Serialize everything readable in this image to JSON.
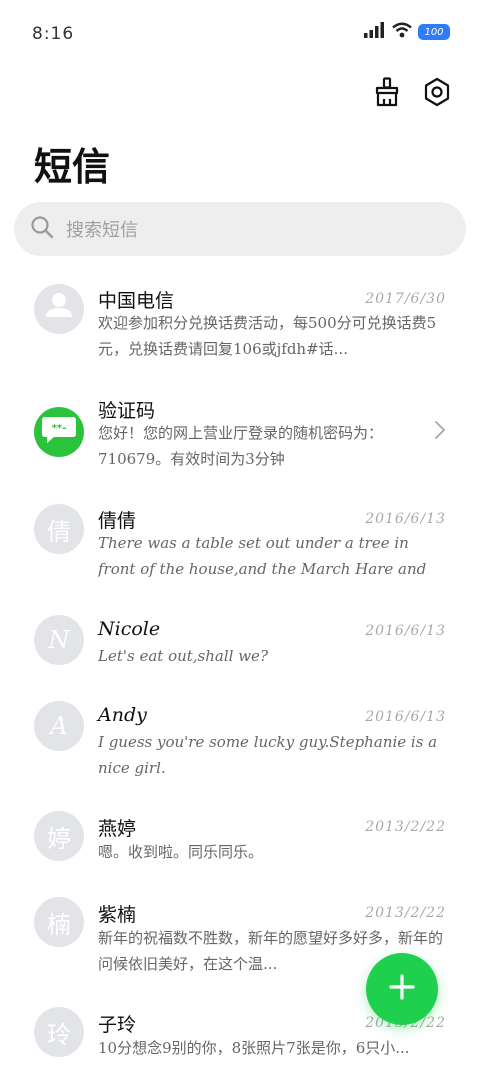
{
  "status": {
    "time": "8:16",
    "battery": "100"
  },
  "header": {
    "title": "短信"
  },
  "search": {
    "placeholder": "搜索短信"
  },
  "messages": [
    {
      "avatar_text": "",
      "name": "中国电信",
      "date": "2017/6/30",
      "preview": "欢迎参加积分兑换话费活动，每500分可兑换话费5元，兑换话费请回复106或jfdh#话..."
    },
    {
      "avatar_text": "**-",
      "name": "验证码",
      "date": "",
      "preview": "您好！您的网上营业厅登录的随机密码为：710679。有效时间为3分钟"
    },
    {
      "avatar_text": "倩",
      "name": "倩倩",
      "date": "2016/6/13",
      "preview": "There was a table set out under a tree in front of the house,and the March Hare and the Hatt..."
    },
    {
      "avatar_text": "N",
      "name": "Nicole",
      "date": "2016/6/13",
      "preview": "Let's eat out,shall we?"
    },
    {
      "avatar_text": "A",
      "name": "Andy",
      "date": "2016/6/13",
      "preview": "I guess you're some lucky guy.Stephanie is a nice girl."
    },
    {
      "avatar_text": "婷",
      "name": "燕婷",
      "date": "2013/2/22",
      "preview": "嗯。收到啦。同乐同乐。"
    },
    {
      "avatar_text": "楠",
      "name": "紫楠",
      "date": "2013/2/22",
      "preview": "新年的祝福数不胜数，新年的愿望好多好多，新年的问候依旧美好，在这个温..."
    },
    {
      "avatar_text": "玲",
      "name": "子玲",
      "date": "2013/2/22",
      "preview": "10分想念9别的你，8张照片7张是你，6只小..."
    }
  ]
}
